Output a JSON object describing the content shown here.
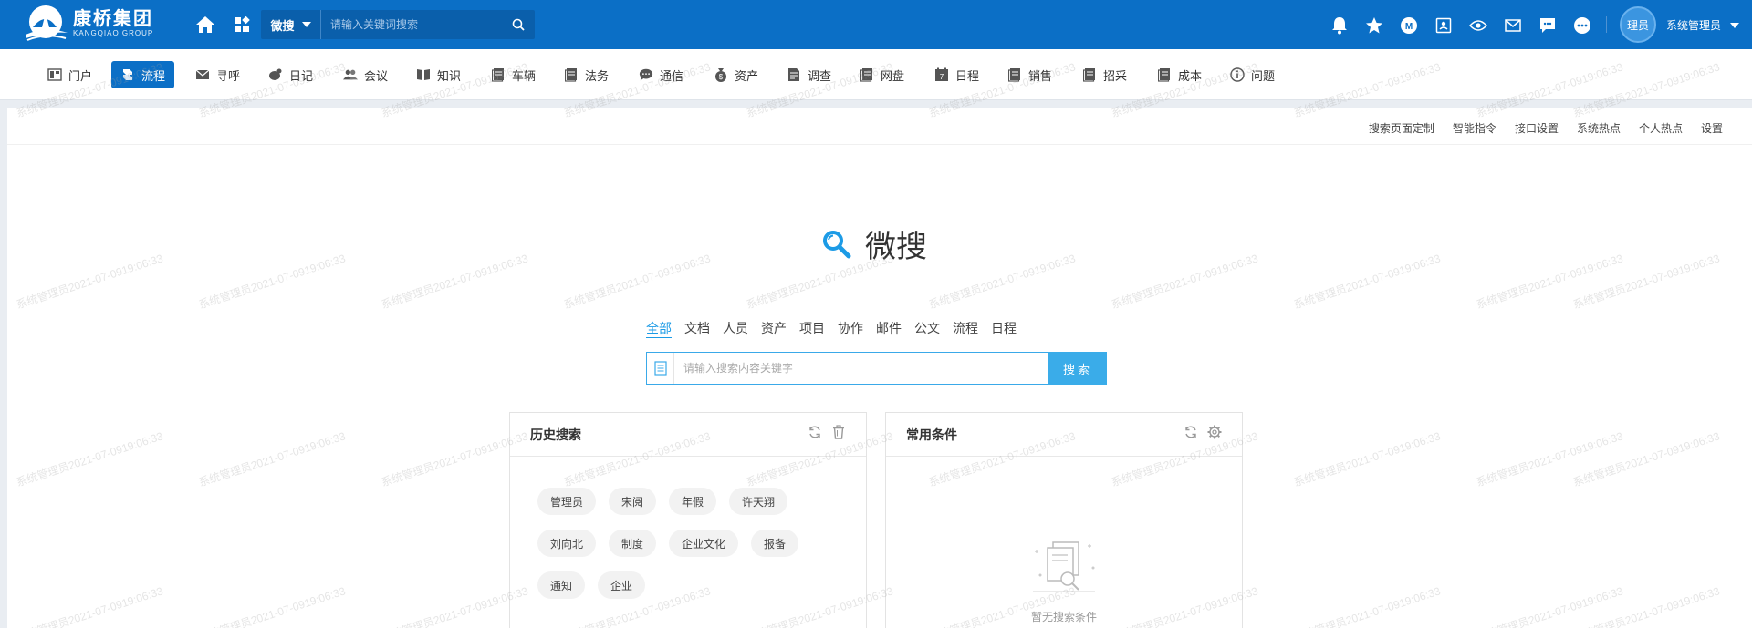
{
  "brand": {
    "name_cn": "康桥集团",
    "name_en": "KANGQIAO GROUP"
  },
  "header": {
    "search_scope": "微搜",
    "search_placeholder": "请输入关键词搜索",
    "user": {
      "avatar_text": "理员",
      "name": "系统管理员"
    },
    "right_icons": [
      "bell-icon",
      "star-icon",
      "m-badge-icon",
      "contact-card-icon",
      "eye-icon",
      "mail-icon",
      "chat-icon",
      "more-icon"
    ]
  },
  "nav": {
    "items": [
      {
        "label": "门户",
        "icon": "portal-icon"
      },
      {
        "label": "流程",
        "icon": "flow-icon",
        "active": true
      },
      {
        "label": "寻呼",
        "icon": "envelope-icon"
      },
      {
        "label": "日记",
        "icon": "diary-icon"
      },
      {
        "label": "会议",
        "icon": "meeting-icon"
      },
      {
        "label": "知识",
        "icon": "book-icon"
      },
      {
        "label": "车辆",
        "icon": "car-icon"
      },
      {
        "label": "法务",
        "icon": "legal-icon"
      },
      {
        "label": "通信",
        "icon": "comm-icon"
      },
      {
        "label": "资产",
        "icon": "asset-icon"
      },
      {
        "label": "调查",
        "icon": "survey-icon"
      },
      {
        "label": "网盘",
        "icon": "disk-icon"
      },
      {
        "label": "日程",
        "icon": "calendar-icon"
      },
      {
        "label": "销售",
        "icon": "sales-icon"
      },
      {
        "label": "招采",
        "icon": "purchase-icon"
      },
      {
        "label": "成本",
        "icon": "cost-icon"
      },
      {
        "label": "问题",
        "icon": "question-icon"
      }
    ]
  },
  "sub_links": [
    "搜索页面定制",
    "智能指令",
    "接口设置",
    "系统热点",
    "个人热点",
    "设置"
  ],
  "page_title": "微搜",
  "categories": [
    {
      "label": "全部",
      "active": true
    },
    {
      "label": "文档"
    },
    {
      "label": "人员"
    },
    {
      "label": "资产"
    },
    {
      "label": "项目"
    },
    {
      "label": "协作"
    },
    {
      "label": "邮件"
    },
    {
      "label": "公文"
    },
    {
      "label": "流程"
    },
    {
      "label": "日程"
    }
  ],
  "main_search": {
    "placeholder": "请输入搜索内容关键字",
    "button": "搜索"
  },
  "history": {
    "title": "历史搜索",
    "tags": [
      "管理员",
      "宋阅",
      "年假",
      "许天翔",
      "刘向北",
      "制度",
      "企业文化",
      "报备",
      "通知",
      "企业"
    ]
  },
  "common": {
    "title": "常用条件",
    "empty_text": "暂无搜索条件"
  },
  "watermark_text": "系统管理员2021-07-0919:06:33",
  "colors": {
    "primary": "#0b6fc6",
    "accent": "#1c9be6",
    "button": "#3aace9"
  }
}
